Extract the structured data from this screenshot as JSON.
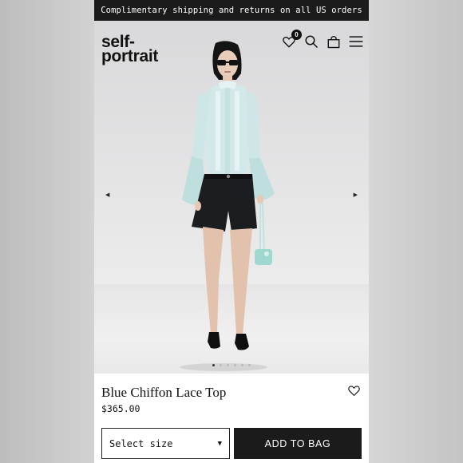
{
  "promo_banner": "Complimentary shipping and returns on all US orders",
  "brand": {
    "line1": "self-",
    "line2": "portrait"
  },
  "header": {
    "wishlist_count": "0",
    "icons": [
      "heart-icon",
      "search-icon",
      "bag-icon",
      "menu-icon"
    ]
  },
  "carousel": {
    "prev_glyph": "◀",
    "next_glyph": "▶",
    "slide_count": 6,
    "active_slide": 1
  },
  "product": {
    "name": "Blue Chiffon Lace Top",
    "price": "$365.00"
  },
  "purchase": {
    "size_placeholder": "Select size",
    "add_to_bag": "ADD TO BAG"
  },
  "colors": {
    "top": "#cfe6e6",
    "shorts": "#1c1d20",
    "accent_dark": "#1b1b1b"
  }
}
